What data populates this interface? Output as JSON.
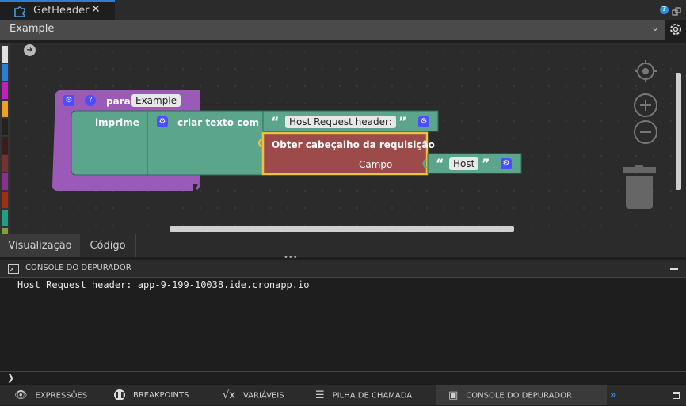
{
  "tab": {
    "title": "GetHeader",
    "close": "✕"
  },
  "selector": {
    "value": "Example"
  },
  "blocks": {
    "para": "para",
    "func_name": "Example",
    "imprime": "imprime",
    "criar": "criar texto com",
    "text_literal": "Host Request header:",
    "obter": "Obter cabeçalho da requisição",
    "campo": "Campo",
    "host": "Host",
    "help": "?"
  },
  "view_tabs": [
    "Visualização",
    "Código"
  ],
  "console": {
    "title": "CONSOLE DO DEPURADOR",
    "output": "Host Request header: app-9-199-10038.ide.cronapp.io",
    "prompt": "❯"
  },
  "status": {
    "items": [
      "EXPRESSÕES",
      "BREAKPOINTS",
      "VARIÁVEIS",
      "PILHA DE CHAMADA",
      "CONSOLE DO DEPURADOR"
    ],
    "more": "»"
  },
  "colors": {
    "accent": "#2a7fd4",
    "proc": "#9c5ab8",
    "text": "#5ba58c",
    "req": "#9c4a4a",
    "highlight": "#f0c040"
  }
}
